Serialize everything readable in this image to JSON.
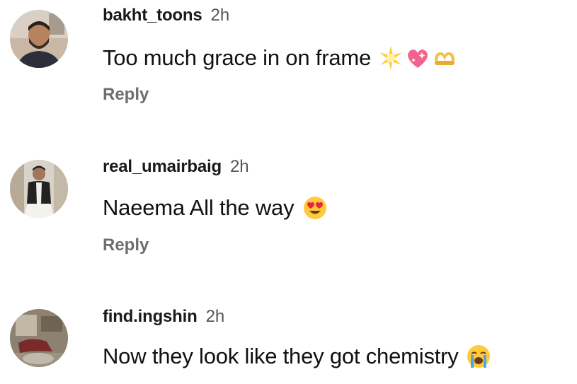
{
  "comments": [
    {
      "username": "bakht_toons",
      "time": "2h",
      "text": "Too much grace in on frame",
      "emojis": [
        "glowing-star-emoji",
        "sparkling-heart-emoji",
        "heart-hands-emoji"
      ],
      "reply_label": "Reply"
    },
    {
      "username": "real_umairbaig",
      "time": "2h",
      "text": "Naeema All the way",
      "emojis": [
        "heart-eyes-emoji"
      ],
      "reply_label": "Reply"
    },
    {
      "username": "find.ingshin",
      "time": "2h",
      "text": "Now they look like they got chemistry",
      "emojis": [
        "loudly-crying-emoji"
      ],
      "reply_label": ""
    }
  ],
  "colors": {
    "username": "#1a1a1a",
    "time": "#555555",
    "text": "#111111",
    "reply": "#6e6e6e",
    "background": "#ffffff"
  }
}
